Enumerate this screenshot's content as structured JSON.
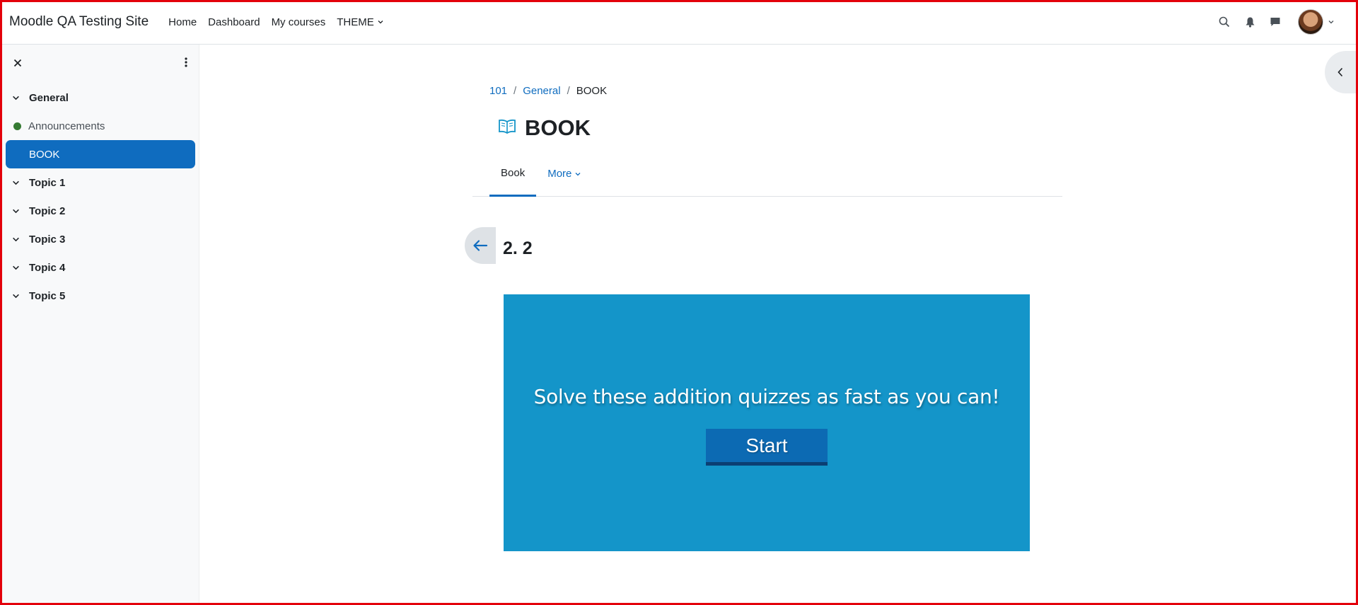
{
  "navbar": {
    "brand": "Moodle QA Testing Site",
    "links": [
      "Home",
      "Dashboard",
      "My courses"
    ],
    "theme_label": "THEME",
    "icons": [
      "search-icon",
      "bell-icon",
      "chat-icon",
      "avatar"
    ]
  },
  "sidebar": {
    "items": [
      {
        "label": "General",
        "type": "section"
      },
      {
        "label": "Announcements",
        "type": "child",
        "status_color": "#357a32"
      },
      {
        "label": "BOOK",
        "type": "active"
      },
      {
        "label": "Topic 1",
        "type": "section"
      },
      {
        "label": "Topic 2",
        "type": "section"
      },
      {
        "label": "Topic 3",
        "type": "section"
      },
      {
        "label": "Topic 4",
        "type": "section"
      },
      {
        "label": "Topic 5",
        "type": "section"
      }
    ]
  },
  "breadcrumb": {
    "items": [
      "101",
      "General",
      "BOOK"
    ],
    "separator": "/"
  },
  "page": {
    "title": "BOOK",
    "tabs": {
      "book": "Book",
      "more": "More"
    },
    "chapter": "2. 2"
  },
  "h5p": {
    "text": "Solve these addition quizzes as fast as you can!",
    "start": "Start",
    "background": "#1495c9"
  },
  "colors": {
    "accent": "#0f6cbf",
    "frame": "#e3000b"
  }
}
